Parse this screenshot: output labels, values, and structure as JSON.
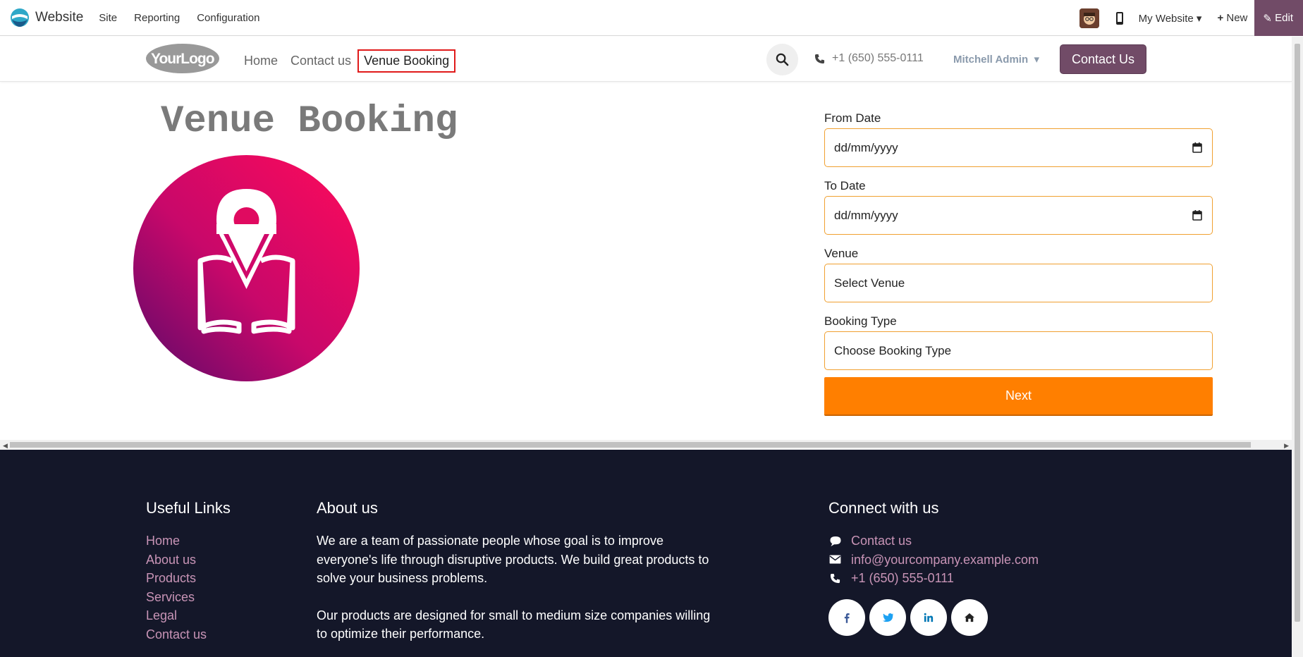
{
  "adminbar": {
    "app_name": "Website",
    "menu": [
      "Site",
      "Reporting",
      "Configuration"
    ],
    "website_selector": "My Website",
    "new_label": "New",
    "edit_label": "Edit"
  },
  "header": {
    "logo_text": "YourLogo",
    "nav": [
      "Home",
      "Contact us"
    ],
    "active_nav": "Venue Booking",
    "phone": "+1 (650) 555-0111",
    "user": "Mitchell Admin",
    "contact_button": "Contact Us"
  },
  "main": {
    "title": "Venue Booking",
    "form": {
      "from_date_label": "From Date",
      "from_date_placeholder": "dd/mm/yyyy",
      "to_date_label": "To Date",
      "to_date_placeholder": "dd/mm/yyyy",
      "venue_label": "Venue",
      "venue_value": "Select Venue",
      "booking_type_label": "Booking Type",
      "booking_type_value": "Choose Booking Type",
      "next_label": "Next"
    }
  },
  "footer": {
    "useful_links_title": "Useful Links",
    "useful_links": [
      "Home",
      "About us",
      "Products",
      "Services",
      "Legal",
      "Contact us"
    ],
    "about_title": "About us",
    "about_p1": "We are a team of passionate people whose goal is to improve everyone's life through disruptive products. We build great products to solve your business problems.",
    "about_p2": "Our products are designed for small to medium size companies willing to optimize their performance.",
    "connect_title": "Connect with us",
    "connect_contact": "Contact us",
    "connect_email": "info@yourcompany.example.com",
    "connect_phone": "+1 (650) 555-0111",
    "socials": [
      "facebook-icon",
      "twitter-icon",
      "linkedin-icon",
      "home-icon"
    ]
  },
  "colors": {
    "brand": "#714b67",
    "accent": "#ff7f00",
    "footer_bg": "#141729",
    "footer_link": "#c894b6"
  }
}
